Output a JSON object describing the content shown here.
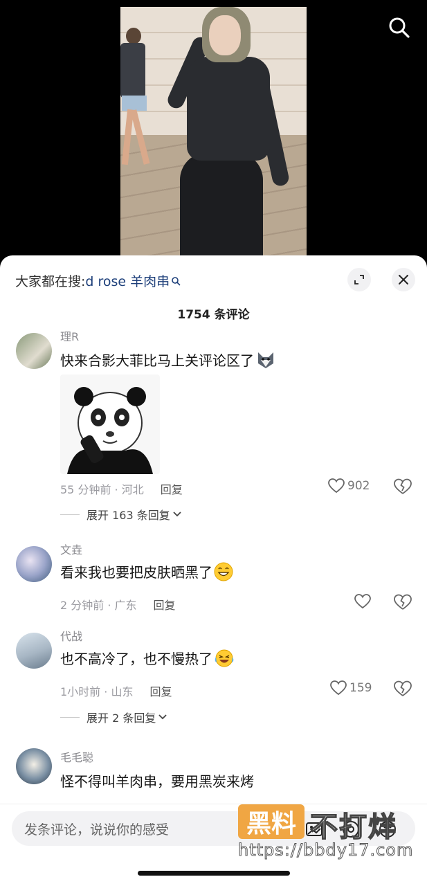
{
  "header": {
    "hot_search_prefix": "大家都在搜:",
    "hot_search_keyword": "d rose 羊肉串",
    "comment_count": "1754 条评论"
  },
  "comments": [
    {
      "username": "理R",
      "text": "快来合影大菲比马上关评论区了",
      "emoji": "wolf-emoji",
      "has_sticker": true,
      "time_location": "55 分钟前 · 河北",
      "reply_label": "回复",
      "likes": "902",
      "expand_label": "展开 163 条回复"
    },
    {
      "username": "文垚",
      "text": "看来我也要把皮肤晒黑了",
      "emoji": "grin-emoji",
      "time_location": "2 分钟前 · 广东",
      "reply_label": "回复",
      "likes": ""
    },
    {
      "username": "代战",
      "text": "也不高冷了，也不慢热了",
      "emoji": "crying-laughing-emoji",
      "time_location": "1小时前 · 山东",
      "reply_label": "回复",
      "likes": "159",
      "expand_label": "展开 2 条回复"
    },
    {
      "username": "毛毛聪",
      "text": "怪不得叫羊肉串，要用黑炭来烤"
    }
  ],
  "input": {
    "placeholder": "发条评论，说说你的感受"
  },
  "watermark": {
    "badge": "黑料",
    "text": "不打烊",
    "url": "https://bbdy17.com"
  },
  "colors": {
    "keyword": "#1d3f7a",
    "watermark_badge": "#f0a23a"
  }
}
